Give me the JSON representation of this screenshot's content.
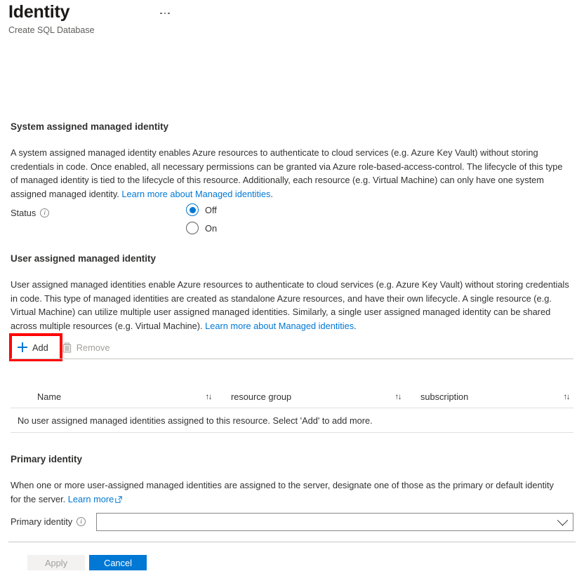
{
  "header": {
    "title": "Identity",
    "subtitle": "Create SQL Database",
    "more_menu": "..."
  },
  "system_identity": {
    "heading": "System assigned managed identity",
    "description_part1": "A system assigned managed identity enables Azure resources to authenticate to cloud services (e.g. Azure Key Vault) without storing credentials in code. Once enabled, all necessary permissions can be granted via Azure role-based-access-control. The lifecycle of this type of managed identity is tied to the lifecycle of this resource. Additionally, each resource (e.g. Virtual Machine) can only have one system assigned managed identity. ",
    "link_text": "Learn more about Managed identities",
    "description_end": ".",
    "status_label": "Status",
    "options": [
      {
        "label": "Off",
        "selected": true
      },
      {
        "label": "On",
        "selected": false
      }
    ]
  },
  "user_identity": {
    "heading": "User assigned managed identity",
    "description_part1": "User assigned managed identities enable Azure resources to authenticate to cloud services (e.g. Azure Key Vault) without storing credentials in code. This type of managed identities are created as standalone Azure resources, and have their own lifecycle. A single resource (e.g. Virtual Machine) can utilize multiple user assigned managed identities. Similarly, a single user assigned managed identity can be shared across multiple resources (e.g. Virtual Machine). ",
    "link_text": "Learn more about Managed identities",
    "description_end": ".",
    "toolbar": {
      "add_label": "Add",
      "remove_label": "Remove"
    },
    "table": {
      "columns": [
        "Name",
        "resource group",
        "subscription"
      ],
      "sort_glyph": "↑↓",
      "empty_message": "No user assigned managed identities assigned to this resource. Select 'Add' to add more.",
      "rows": []
    }
  },
  "primary_identity": {
    "heading": "Primary identity",
    "description": "When one or more user-assigned managed identities are assigned to the server, designate one of those as the primary or default identity for the server. ",
    "link_text": "Learn more",
    "field_label": "Primary identity",
    "dropdown_value": "",
    "dropdown_placeholder": ""
  },
  "footer": {
    "apply_label": "Apply",
    "cancel_label": "Cancel"
  },
  "colors": {
    "accent": "#0078d4",
    "highlight": "#ff0000",
    "text": "#323130",
    "muted": "#605e5c",
    "disabled": "#a19f9d",
    "divider": "#c8c6c4"
  }
}
